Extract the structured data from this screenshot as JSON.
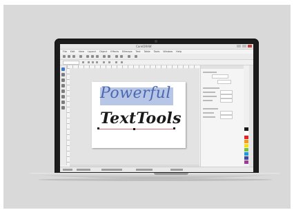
{
  "app": {
    "title": "CorelDRAW",
    "menu": [
      "File",
      "Edit",
      "View",
      "Layout",
      "Object",
      "Effects",
      "Bitmaps",
      "Text",
      "Table",
      "Tools",
      "Window",
      "Help"
    ]
  },
  "canvas": {
    "line1": "Powerful",
    "line2": "TextTools"
  },
  "colors": {
    "highlight": "#b7c6e6",
    "line1_text": "#4a67b0",
    "line2_text": "#1a1a1a",
    "accent_tool": "#3f78c9"
  },
  "palette": [
    "#1a1a1a",
    "#ffffff",
    "#e5212b",
    "#f39c1a",
    "#f7e11b",
    "#7ac143",
    "#1f9ad6",
    "#3d4aa0",
    "#9c3b95",
    "#e8418f",
    "#8c5a2b",
    "#6b6b6b"
  ],
  "icons": [
    "pointer-icon",
    "shape-icon",
    "zoom-icon",
    "freehand-icon",
    "rectangle-icon",
    "ellipse-icon",
    "text-icon",
    "fill-icon"
  ]
}
